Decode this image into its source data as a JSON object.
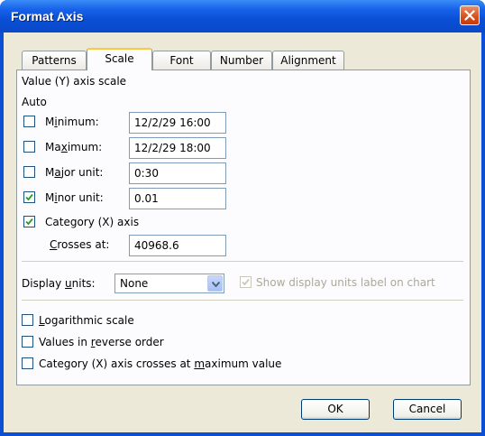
{
  "window": {
    "title": "Format Axis"
  },
  "tabs": [
    "Patterns",
    "Scale",
    "Font",
    "Number",
    "Alignment"
  ],
  "scale": {
    "heading": "Value (Y) axis scale",
    "auto_label": "Auto",
    "minimum": {
      "label": "Minimum:",
      "checked": false,
      "value": "12/2/29 16:00"
    },
    "maximum": {
      "label": "Maximum:",
      "checked": false,
      "value": "12/2/29 18:00"
    },
    "major_unit": {
      "label": "Major unit:",
      "checked": false,
      "value": "0:30"
    },
    "minor_unit": {
      "label": "Minor unit:",
      "checked": true,
      "value": "0.01"
    },
    "category_axis": {
      "label": "Category (X) axis",
      "checked": true
    },
    "crosses_at": {
      "label": "Crosses at:",
      "value": "40968.6"
    }
  },
  "display_units": {
    "label": "Display units:",
    "selected": "None",
    "show_label": {
      "label": "Show display units label on chart",
      "checked": true,
      "enabled": false
    }
  },
  "options": {
    "logarithmic": {
      "label": "Logarithmic scale",
      "checked": false
    },
    "reverse_order": {
      "label": "Values in reverse order",
      "checked": false
    },
    "crosses_max": {
      "label": "Category (X) axis crosses at maximum value",
      "checked": false
    }
  },
  "buttons": {
    "ok": "OK",
    "cancel": "Cancel"
  },
  "colors": {
    "titlebar": "#0a4fd6",
    "tab_highlight": "#ffc73c",
    "close_button": "#d9531e",
    "check_mark": "#21a121"
  },
  "icons": {
    "close": "close-x-icon",
    "check": "check-mark-icon",
    "dropdown": "chevron-down-icon"
  }
}
